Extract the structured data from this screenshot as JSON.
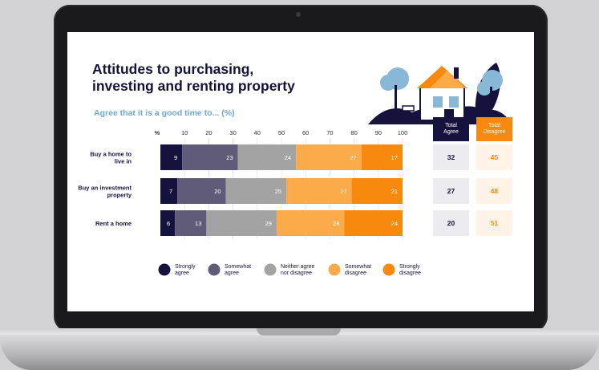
{
  "chart_data": {
    "type": "bar",
    "stacked": true,
    "orientation": "horizontal",
    "title": "Attitudes to purchasing,\ninvesting and renting property",
    "subtitle": "Agree that it is a good time to... (%)",
    "categories": [
      "Buy a home to\nlive in",
      "Buy an investment\nproperty",
      "Rent a home"
    ],
    "series": [
      {
        "name": "Strongly\nagree",
        "color": "#16123e",
        "label_color": "#ffffff",
        "values": [
          9,
          7,
          6
        ]
      },
      {
        "name": "Somewhat\nagree",
        "color": "#5f5b78",
        "label_color": "#ffffff",
        "values": [
          23,
          20,
          13
        ]
      },
      {
        "name": "Neither agree\nnor disagree",
        "color": "#a3a3a3",
        "label_color": "#ffffff",
        "values": [
          24,
          25,
          29
        ]
      },
      {
        "name": "Somewhat\ndisagree",
        "color": "#fbab4a",
        "label_color": "#ffffff",
        "values": [
          27,
          27,
          28
        ]
      },
      {
        "name": "Strongly\ndisagree",
        "color": "#f7890f",
        "label_color": "#ffffff",
        "values": [
          17,
          21,
          24
        ]
      }
    ],
    "x_unit_label": "%",
    "x_ticks": [
      10,
      20,
      30,
      40,
      50,
      60,
      70,
      80,
      90,
      100
    ],
    "xlim": [
      0,
      100
    ],
    "legend_position": "bottom",
    "totals": {
      "agree": {
        "header": "Total\nAgree",
        "header_bg": "#16123e",
        "values": [
          32,
          27,
          20
        ]
      },
      "disagree": {
        "header": "Total\nDisagree",
        "header_bg": "#f7890f",
        "values": [
          45,
          48,
          51
        ]
      }
    }
  }
}
